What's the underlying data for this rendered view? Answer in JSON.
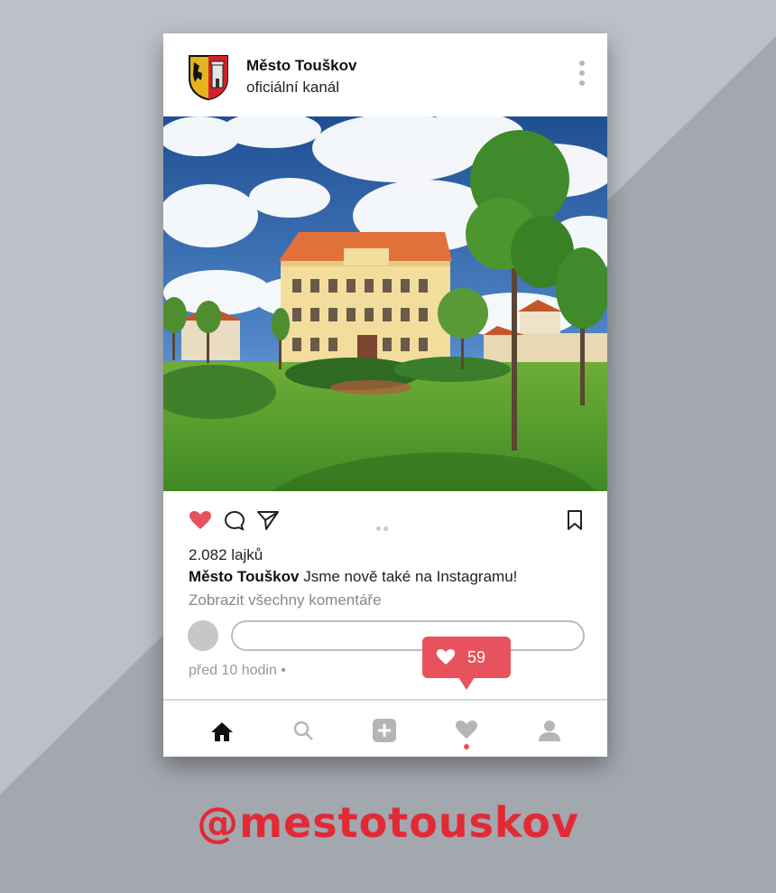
{
  "colors": {
    "background": "#aaaeb5",
    "accent_red": "#e8525d",
    "handle_red": "#e12a35"
  },
  "post": {
    "account_name": "Město Touškov",
    "account_subtitle": "oficiální kanál",
    "likes": "2.082 lajků",
    "caption_author": "Město Touškov",
    "caption_text": " Jsme nově také na Instagramu!",
    "view_comments": "Zobrazit všechny komentáře",
    "time": "před 10 hodin •",
    "comment_placeholder": ""
  },
  "icons": {
    "like": "heart-filled-icon",
    "comment": "comment-bubble-icon",
    "share": "paper-plane-icon",
    "save": "bookmark-icon",
    "more": "vertical-dots-icon"
  },
  "notification": {
    "icon": "heart-icon",
    "count": "59"
  },
  "bottom_nav": {
    "items": [
      "home-icon",
      "search-icon",
      "add-post-icon",
      "activity-heart-icon",
      "profile-icon"
    ],
    "active_indicator": "activity-heart-icon"
  },
  "handle": "@mestotouskov"
}
